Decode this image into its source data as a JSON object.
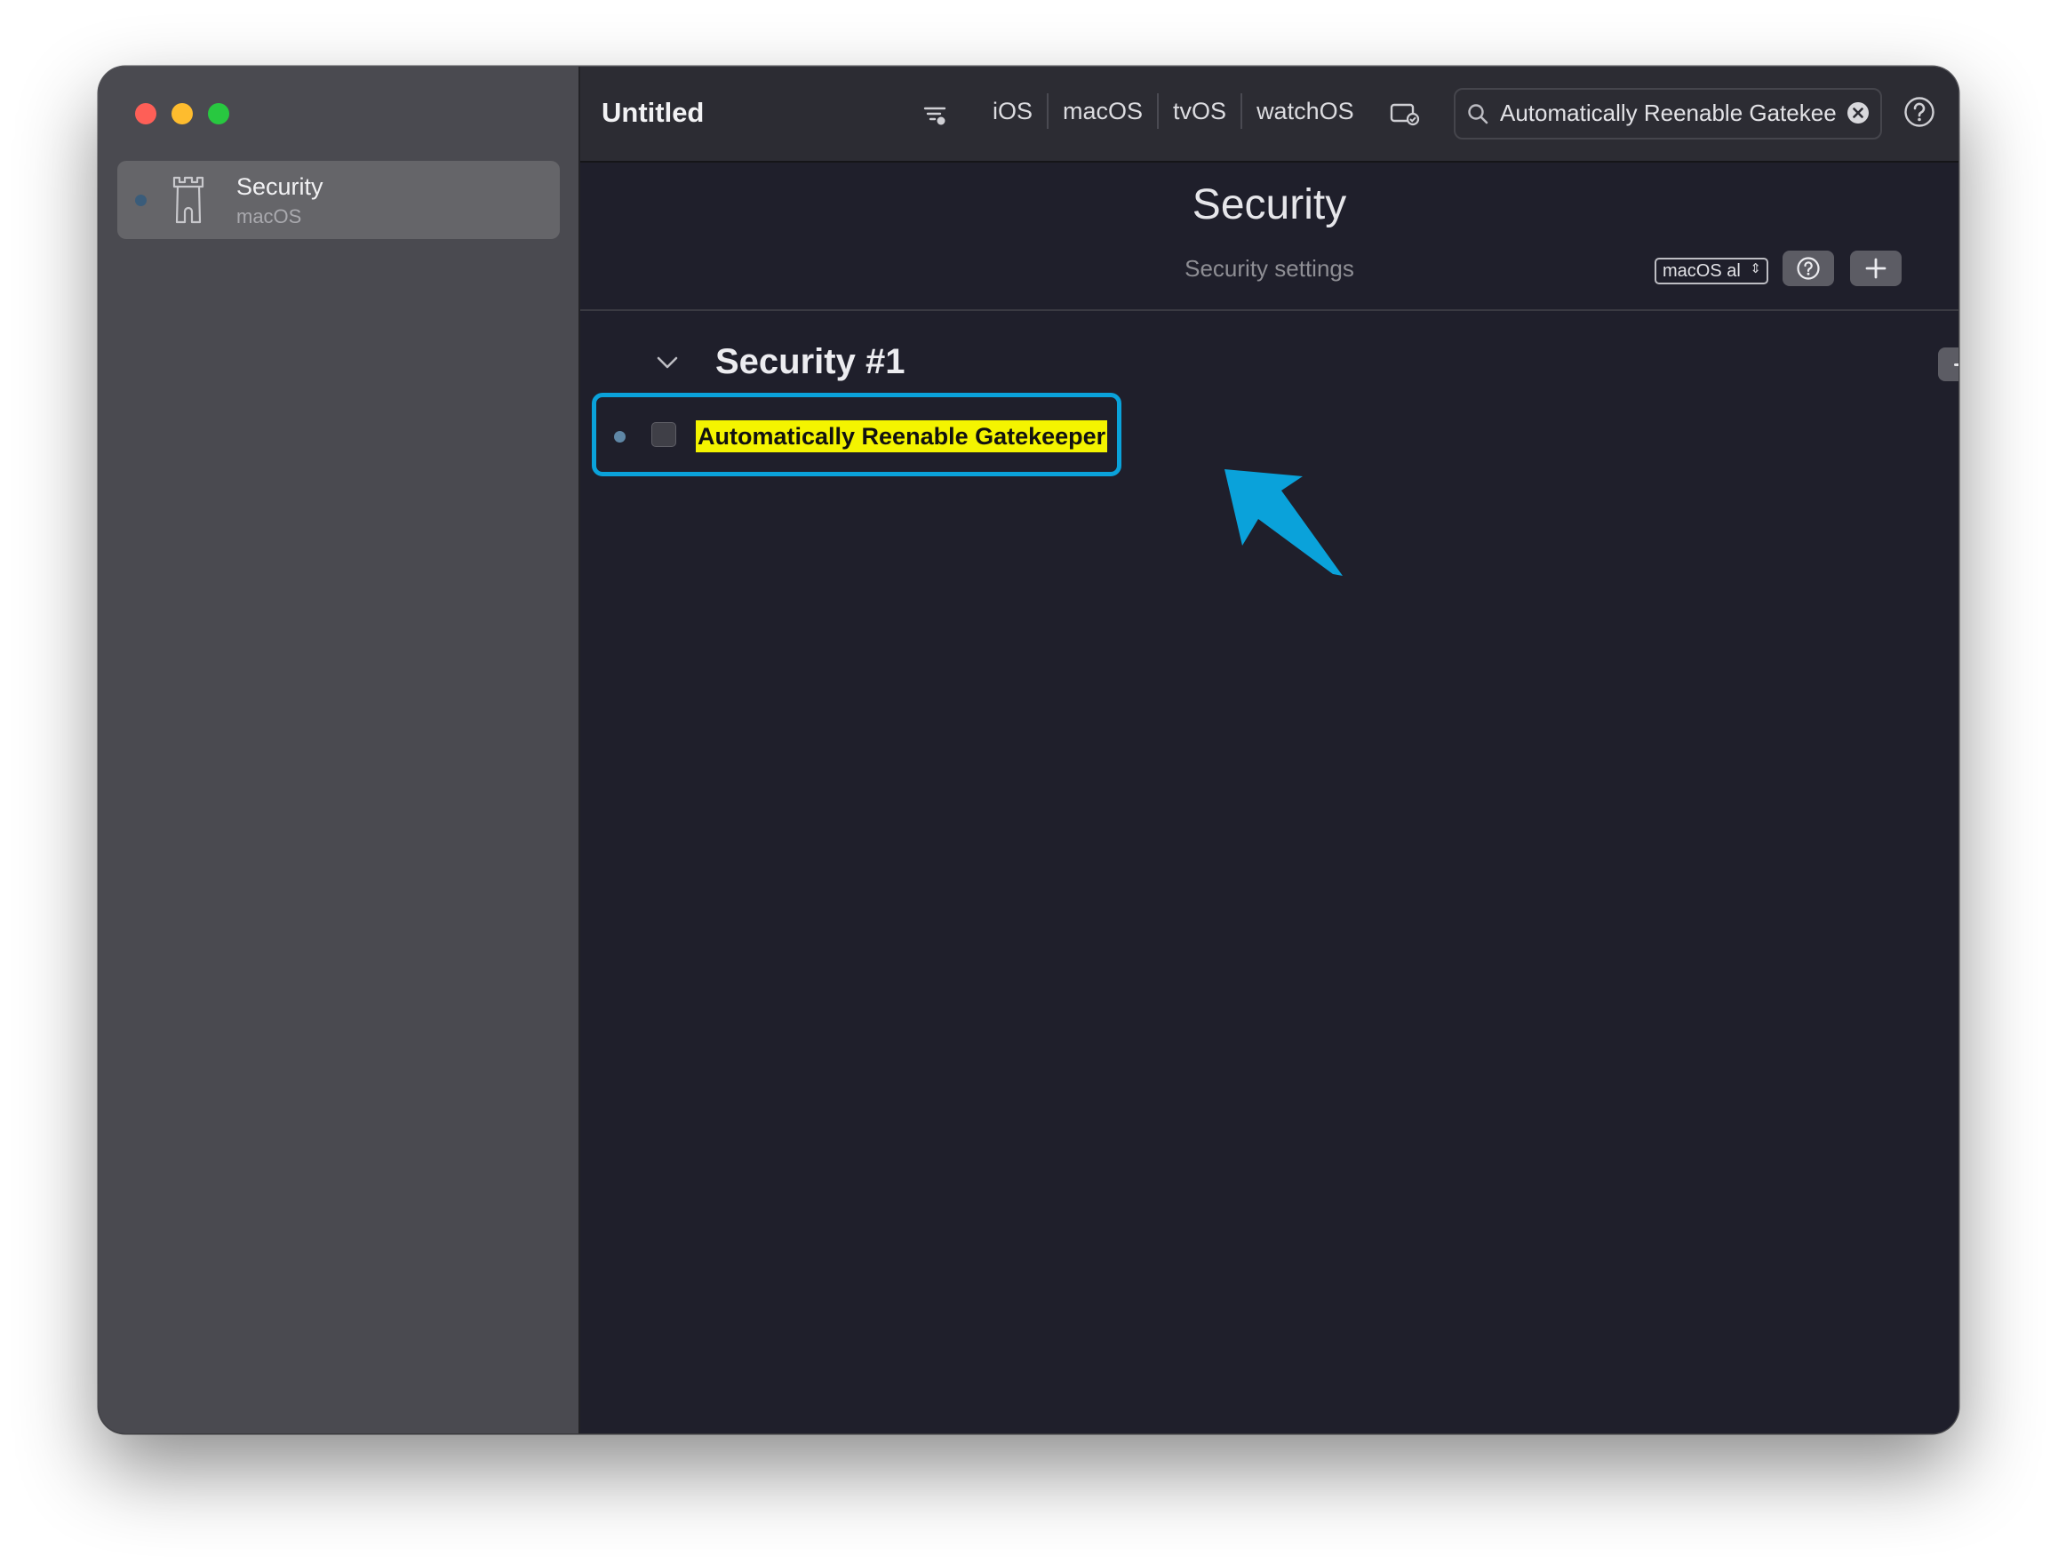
{
  "window": {
    "title": "Untitled",
    "traffic_lights": [
      "close",
      "minimize",
      "zoom"
    ]
  },
  "sidebar": {
    "items": [
      {
        "title": "Security",
        "subtitle": "macOS",
        "icon": "castle-tower-icon",
        "selected": true
      }
    ]
  },
  "toolbar": {
    "filter_icon": "filter-icon",
    "platforms": [
      "iOS",
      "macOS",
      "tvOS",
      "watchOS"
    ],
    "device_icon": "device-check-icon",
    "search": {
      "value": "Automatically Reenable Gatekeeper",
      "placeholder": ""
    },
    "clear_icon": "clear-circle-icon",
    "help_icon": "help-icon"
  },
  "payload": {
    "title": "Security",
    "subtitle": "Security settings",
    "os_select": {
      "value": "macOS  al"
    },
    "help_button_icon": "question-circle-icon",
    "add_button_icon": "plus-icon"
  },
  "section": {
    "title": "Security #1",
    "remove_button_icon": "minus-icon",
    "items": [
      {
        "label": "Automatically Reenable Gatekeeper",
        "checked": false,
        "highlighted": true
      }
    ]
  },
  "colors": {
    "sidebar_bg": "#4a4a50",
    "main_bg": "#1f1f2b",
    "toolbar_bg": "#2c2c33",
    "highlight_text_bg": "#f4f400",
    "callout_accent": "#0aa2da"
  }
}
